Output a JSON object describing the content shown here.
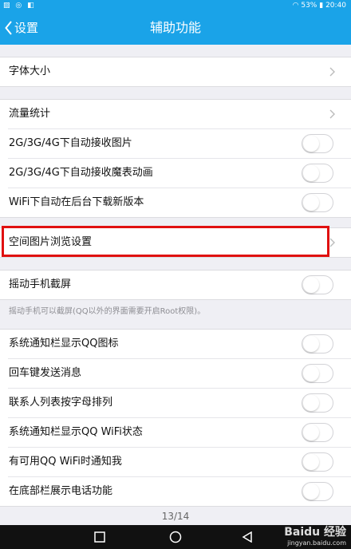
{
  "status_bar": {
    "left_icons": "▨ ◎ ◧",
    "battery": "53%",
    "time": "20:40"
  },
  "nav": {
    "back_label": "设置",
    "title": "辅助功能"
  },
  "group1": [
    {
      "label": "字体大小"
    }
  ],
  "group2": [
    {
      "label": "流量统计"
    },
    {
      "label": "2G/3G/4G下自动接收图片",
      "on": false
    },
    {
      "label": "2G/3G/4G下自动接收魔表动画",
      "on": false
    },
    {
      "label": "WiFi下自动在后台下载新版本",
      "on": false
    }
  ],
  "group3": [
    {
      "label": "空间图片浏览设置"
    }
  ],
  "group4": [
    {
      "label": "摇动手机截屏",
      "on": false
    }
  ],
  "shake_note": "摇动手机可以截屏(QQ以外的界面需要开启Root权限)。",
  "group5": [
    {
      "label": "系统通知栏显示QQ图标",
      "on": false
    },
    {
      "label": "回车键发送消息",
      "on": false
    },
    {
      "label": "联系人列表按字母排列",
      "on": false
    },
    {
      "label": "系统通知栏显示QQ WiFi状态",
      "on": false
    },
    {
      "label": "有可用QQ WiFi时通知我",
      "on": false
    },
    {
      "label": "在底部栏展示电话功能",
      "on": false
    }
  ],
  "pager": "13/14",
  "watermark": {
    "brand": "Baidu 经验",
    "url": "jingyan.baidu.com"
  },
  "colors": {
    "accent": "#1aa3e8",
    "highlight": "#e01010"
  }
}
